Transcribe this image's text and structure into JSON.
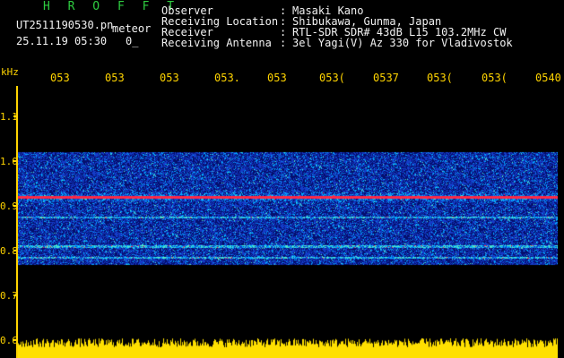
{
  "header": {
    "brand": "H R O F F T",
    "filename": "UT2511190530.pn",
    "meteor_label": "meteor",
    "datetime": "25.11.19 05:30",
    "count": "0_",
    "fields": [
      {
        "label": "Observer",
        "value": "Masaki Kano"
      },
      {
        "label": "Receiving Location",
        "value": "Shibukawa, Gunma, Japan"
      },
      {
        "label": "Receiver",
        "value": "RTL-SDR SDR# 43dB L15 103.2MHz CW"
      },
      {
        "label": "Receiving Antenna",
        "value": "3el Yagi(V) Az 330 for Vladivostok"
      }
    ]
  },
  "axes": {
    "unit": "kHz",
    "time_ticks": [
      "053",
      "053",
      "053",
      "053.",
      "053",
      "053(",
      "0537",
      "053(",
      "053(",
      "0540"
    ],
    "freq_ticks": [
      "1.1",
      "1.0",
      "0.9",
      "0.8",
      "0.7",
      "0.6"
    ]
  },
  "colors": {
    "background": "#000000",
    "label_yellow": "#ffd400",
    "brand_green": "#2ecc40",
    "noise_low": "#1030c0",
    "noise_mid": "#00c8ff",
    "signal_peak": "#ff2040",
    "meter": "#ffe000"
  },
  "spectrogram": {
    "band_top_khz": 1.02,
    "band_bottom_khz": 0.77,
    "carrier_khz": 0.92,
    "secondary_khz": [
      0.875,
      0.81,
      0.785
    ],
    "freq_max_khz": 1.15,
    "freq_min_khz": 0.6
  }
}
